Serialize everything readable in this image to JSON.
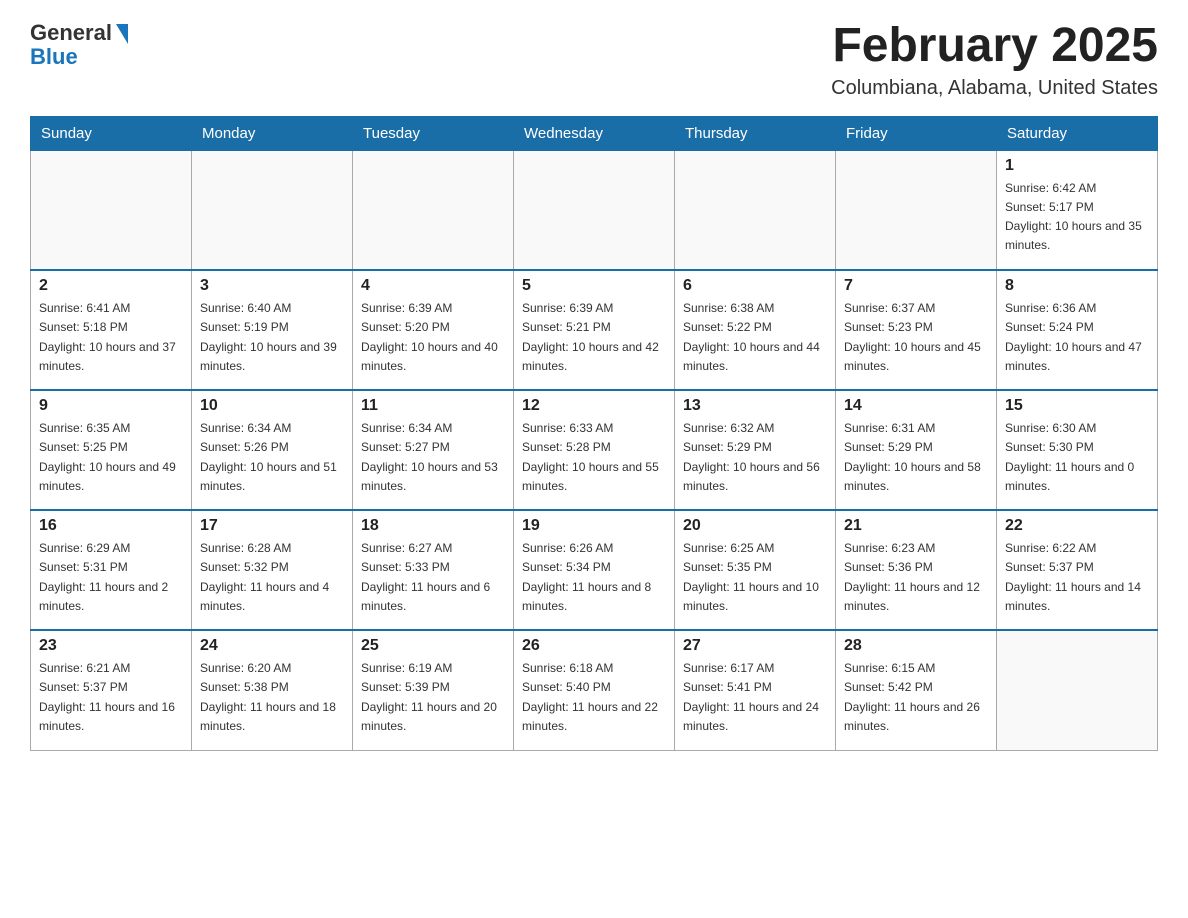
{
  "header": {
    "logo_general": "General",
    "logo_blue": "Blue",
    "month_title": "February 2025",
    "location": "Columbiana, Alabama, United States"
  },
  "days_of_week": [
    "Sunday",
    "Monday",
    "Tuesday",
    "Wednesday",
    "Thursday",
    "Friday",
    "Saturday"
  ],
  "weeks": [
    [
      {
        "day": "",
        "info": ""
      },
      {
        "day": "",
        "info": ""
      },
      {
        "day": "",
        "info": ""
      },
      {
        "day": "",
        "info": ""
      },
      {
        "day": "",
        "info": ""
      },
      {
        "day": "",
        "info": ""
      },
      {
        "day": "1",
        "info": "Sunrise: 6:42 AM\nSunset: 5:17 PM\nDaylight: 10 hours and 35 minutes."
      }
    ],
    [
      {
        "day": "2",
        "info": "Sunrise: 6:41 AM\nSunset: 5:18 PM\nDaylight: 10 hours and 37 minutes."
      },
      {
        "day": "3",
        "info": "Sunrise: 6:40 AM\nSunset: 5:19 PM\nDaylight: 10 hours and 39 minutes."
      },
      {
        "day": "4",
        "info": "Sunrise: 6:39 AM\nSunset: 5:20 PM\nDaylight: 10 hours and 40 minutes."
      },
      {
        "day": "5",
        "info": "Sunrise: 6:39 AM\nSunset: 5:21 PM\nDaylight: 10 hours and 42 minutes."
      },
      {
        "day": "6",
        "info": "Sunrise: 6:38 AM\nSunset: 5:22 PM\nDaylight: 10 hours and 44 minutes."
      },
      {
        "day": "7",
        "info": "Sunrise: 6:37 AM\nSunset: 5:23 PM\nDaylight: 10 hours and 45 minutes."
      },
      {
        "day": "8",
        "info": "Sunrise: 6:36 AM\nSunset: 5:24 PM\nDaylight: 10 hours and 47 minutes."
      }
    ],
    [
      {
        "day": "9",
        "info": "Sunrise: 6:35 AM\nSunset: 5:25 PM\nDaylight: 10 hours and 49 minutes."
      },
      {
        "day": "10",
        "info": "Sunrise: 6:34 AM\nSunset: 5:26 PM\nDaylight: 10 hours and 51 minutes."
      },
      {
        "day": "11",
        "info": "Sunrise: 6:34 AM\nSunset: 5:27 PM\nDaylight: 10 hours and 53 minutes."
      },
      {
        "day": "12",
        "info": "Sunrise: 6:33 AM\nSunset: 5:28 PM\nDaylight: 10 hours and 55 minutes."
      },
      {
        "day": "13",
        "info": "Sunrise: 6:32 AM\nSunset: 5:29 PM\nDaylight: 10 hours and 56 minutes."
      },
      {
        "day": "14",
        "info": "Sunrise: 6:31 AM\nSunset: 5:29 PM\nDaylight: 10 hours and 58 minutes."
      },
      {
        "day": "15",
        "info": "Sunrise: 6:30 AM\nSunset: 5:30 PM\nDaylight: 11 hours and 0 minutes."
      }
    ],
    [
      {
        "day": "16",
        "info": "Sunrise: 6:29 AM\nSunset: 5:31 PM\nDaylight: 11 hours and 2 minutes."
      },
      {
        "day": "17",
        "info": "Sunrise: 6:28 AM\nSunset: 5:32 PM\nDaylight: 11 hours and 4 minutes."
      },
      {
        "day": "18",
        "info": "Sunrise: 6:27 AM\nSunset: 5:33 PM\nDaylight: 11 hours and 6 minutes."
      },
      {
        "day": "19",
        "info": "Sunrise: 6:26 AM\nSunset: 5:34 PM\nDaylight: 11 hours and 8 minutes."
      },
      {
        "day": "20",
        "info": "Sunrise: 6:25 AM\nSunset: 5:35 PM\nDaylight: 11 hours and 10 minutes."
      },
      {
        "day": "21",
        "info": "Sunrise: 6:23 AM\nSunset: 5:36 PM\nDaylight: 11 hours and 12 minutes."
      },
      {
        "day": "22",
        "info": "Sunrise: 6:22 AM\nSunset: 5:37 PM\nDaylight: 11 hours and 14 minutes."
      }
    ],
    [
      {
        "day": "23",
        "info": "Sunrise: 6:21 AM\nSunset: 5:37 PM\nDaylight: 11 hours and 16 minutes."
      },
      {
        "day": "24",
        "info": "Sunrise: 6:20 AM\nSunset: 5:38 PM\nDaylight: 11 hours and 18 minutes."
      },
      {
        "day": "25",
        "info": "Sunrise: 6:19 AM\nSunset: 5:39 PM\nDaylight: 11 hours and 20 minutes."
      },
      {
        "day": "26",
        "info": "Sunrise: 6:18 AM\nSunset: 5:40 PM\nDaylight: 11 hours and 22 minutes."
      },
      {
        "day": "27",
        "info": "Sunrise: 6:17 AM\nSunset: 5:41 PM\nDaylight: 11 hours and 24 minutes."
      },
      {
        "day": "28",
        "info": "Sunrise: 6:15 AM\nSunset: 5:42 PM\nDaylight: 11 hours and 26 minutes."
      },
      {
        "day": "",
        "info": ""
      }
    ]
  ]
}
